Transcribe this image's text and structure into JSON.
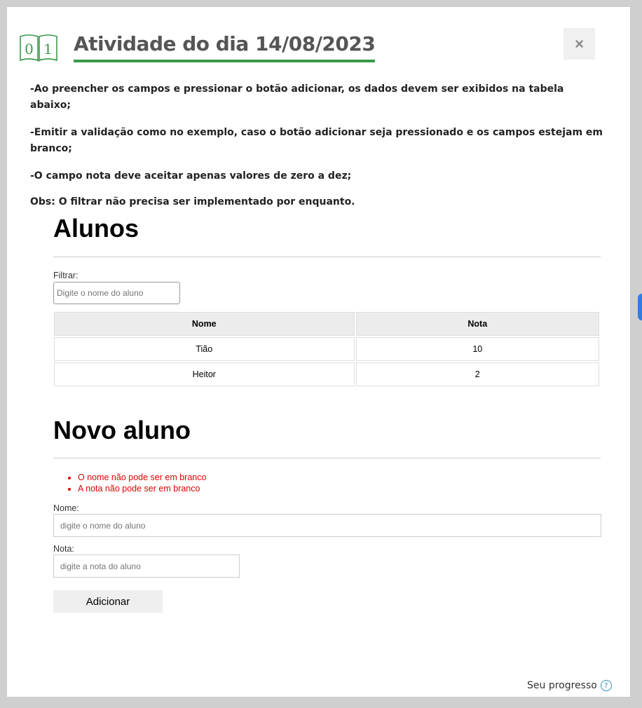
{
  "header": {
    "logo_digits": [
      "0",
      "1"
    ],
    "title": "Atividade do dia 14/08/2023",
    "close_label": "×"
  },
  "instructions": [
    "-Ao preencher os campos e pressionar o botão adicionar, os dados devem ser exibidos na tabela abaixo;",
    "-Emitir a validação como no exemplo, caso o botão adicionar seja pressionado e os campos estejam em branco;",
    "-O campo nota deve aceitar apenas valores de zero a dez;",
    "Obs: O filtrar não precisa ser implementado por enquanto."
  ],
  "students": {
    "heading": "Alunos",
    "filter_label": "Filtrar:",
    "filter_placeholder": "Digite o nome do aluno",
    "columns": [
      "Nome",
      "Nota"
    ],
    "rows": [
      {
        "name": "Tião",
        "grade": "10"
      },
      {
        "name": "Heitor",
        "grade": "2"
      }
    ]
  },
  "new_student": {
    "heading": "Novo aluno",
    "errors": [
      "O nome não pode ser em branco",
      "A nota não pode ser em branco"
    ],
    "name_label": "Nome:",
    "name_placeholder": "digite o nome do aluno",
    "grade_label": "Nota:",
    "grade_placeholder": "digite a nota do aluno",
    "add_label": "Adicionar"
  },
  "footer": {
    "progress_label": "Seu progresso",
    "help_icon": "?"
  },
  "colors": {
    "accent_green": "#3a9a4a",
    "error_red": "#e00000",
    "help_blue": "#2a8fc0"
  }
}
